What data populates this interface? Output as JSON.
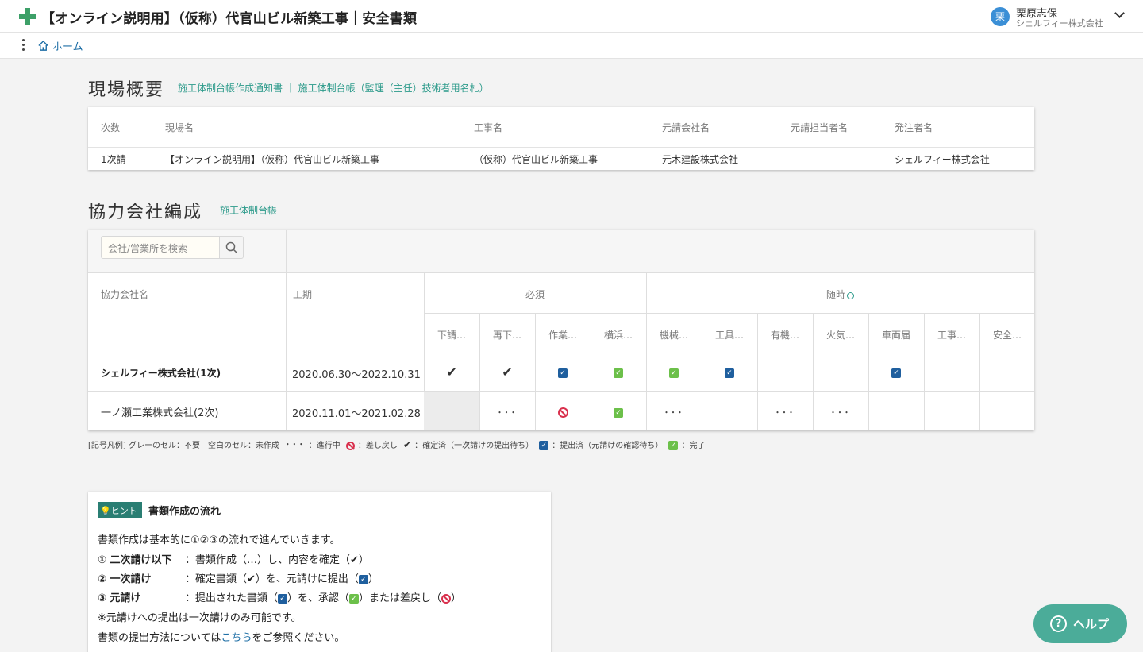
{
  "header": {
    "title": "【オンライン説明用】（仮称）代官山ビル新築工事｜安全書類",
    "user_initial": "栗",
    "user_name": "栗原志保",
    "user_company": "シェルフィー株式会社"
  },
  "nav": {
    "home_label": "ホーム"
  },
  "overview": {
    "title": "現場概要",
    "links": "施工体制台帳作成通知書 ｜ 施工体制台帳（監理（主任）技術者用名札）",
    "headers": [
      "次数",
      "現場名",
      "工事名",
      "元請会社名",
      "元請担当者名",
      "発注者名"
    ],
    "values": [
      "1次請",
      "【オンライン説明用】（仮称）代官山ビル新築工事",
      "（仮称）代官山ビル新築工事",
      "元木建設株式会社",
      "",
      "シェルフィー株式会社"
    ]
  },
  "partners": {
    "title": "協力会社編成",
    "link": "施工体制台帳",
    "search_placeholder": "会社/営業所を検索",
    "col_company": "協力会社名",
    "col_period": "工期",
    "group_required": "必須",
    "group_optional": "随時",
    "doc_columns": [
      "下請…",
      "再下…",
      "作業…",
      "横浜…",
      "機械…",
      "工具…",
      "有機…",
      "火気…",
      "車両届",
      "工事…",
      "安全…"
    ],
    "rows": [
      {
        "company": "シェルフィー株式会社(1次)",
        "period": "2020.06.30〜2022.10.31",
        "status": [
          "confirmed",
          "confirmed",
          "submitted",
          "complete",
          "complete",
          "submitted",
          "empty",
          "empty",
          "submitted",
          "empty",
          "empty"
        ]
      },
      {
        "company": "一ノ瀬工業株式会社(2次)",
        "period": "2020.11.01〜2021.02.28",
        "status": [
          "not-required",
          "in-progress",
          "returned",
          "complete",
          "in-progress",
          "empty",
          "in-progress",
          "in-progress",
          "empty",
          "empty",
          "empty"
        ]
      }
    ],
    "symbols": {
      "in_progress": "･･･",
      "confirmed": "✔",
      "submitted_mark": "✓",
      "complete_mark": "✓"
    }
  },
  "legend": {
    "prefix": "[記号凡例] グレーのセル：不要　空白のセル：未作成",
    "in_progress_label": "：進行中",
    "returned_label": "：差し戻し",
    "confirmed_label": "：確定済（一次請けの提出待ち）",
    "submitted_label": "：提出済（元請けの確認待ち）",
    "complete_label": "：完了"
  },
  "hint": {
    "tag": "💡ヒント",
    "title": "書類作成の流れ",
    "intro": "書類作成は基本的に①②③の流れで進んでいきます。",
    "step1_label": "① 二次請け以下",
    "step1_text": "：書類作成（…）し、内容を確定（✔）",
    "step2_label": "② 一次請け",
    "step2_text_a": "：確定書類（✔）を、元請けに提出（",
    "step2_text_b": "）",
    "step3_label": "③ 元請け",
    "step3_text_a": "：提出された書類（",
    "step3_text_b": "）を、承認（",
    "step3_text_c": "）または差戻し（",
    "step3_text_d": "）",
    "note": "※元請けへの提出は一次請けのみ可能です。",
    "method_a": "書類の提出方法については",
    "method_link": "こちら",
    "method_b": "をご参照ください。"
  },
  "help": {
    "label": "ヘルプ"
  }
}
